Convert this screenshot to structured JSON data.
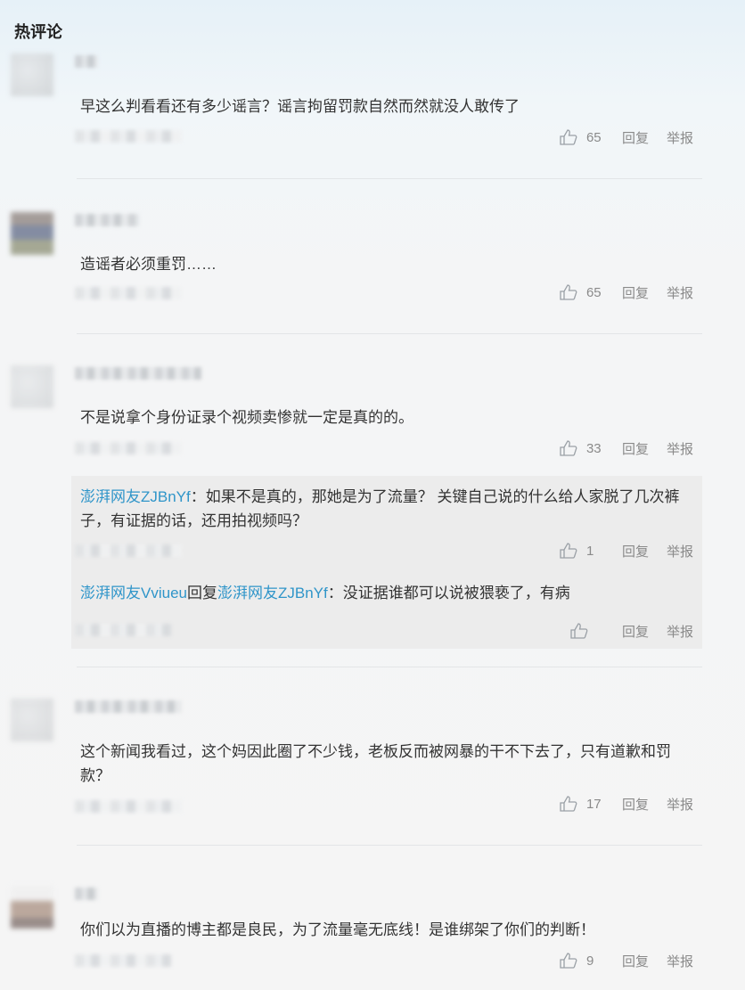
{
  "section_title": "热评论",
  "comments": [
    {
      "text": "早这么判看看还有多少谣言？谣言拘留罚款自然而然就没人敢传了",
      "likes": "65",
      "reply": "回复",
      "report": "举报"
    },
    {
      "text": "造谣者必须重罚……",
      "likes": "65",
      "reply": "回复",
      "report": "举报"
    },
    {
      "text": "不是说拿个身份证录个视频卖惨就一定是真的的。",
      "likes": "33",
      "reply": "回复",
      "report": "举报",
      "replies": [
        {
          "user": "澎湃网友ZJBnYf",
          "sep": "：",
          "text": "如果不是真的，那她是为了流量？ 关键自己说的什么给人家脱了几次裤子，有证据的话，还用拍视频吗？",
          "likes": "1",
          "reply": "回复",
          "report": "举报"
        },
        {
          "user": "澎湃网友Vviueu",
          "mid": "回复",
          "target": "澎湃网友ZJBnYf",
          "sep": "：",
          "text": "没证据谁都可以说被猥亵了，有病",
          "likes": "",
          "reply": "回复",
          "report": "举报"
        }
      ]
    },
    {
      "text": "这个新闻我看过，这个妈因此圈了不少钱，老板反而被网暴的干不下去了，只有道歉和罚款？",
      "likes": "17",
      "reply": "回复",
      "report": "举报"
    },
    {
      "text": "你们以为直播的博主都是良民，为了流量毫无底线！是谁绑架了你们的判断！",
      "likes": "9",
      "reply": "回复",
      "report": "举报"
    }
  ],
  "colors": {
    "username": "#2f95c9",
    "muted": "#8a8a8a",
    "reply_bg": "#ececec"
  },
  "icons": {
    "like": "thumbs-up-icon"
  }
}
